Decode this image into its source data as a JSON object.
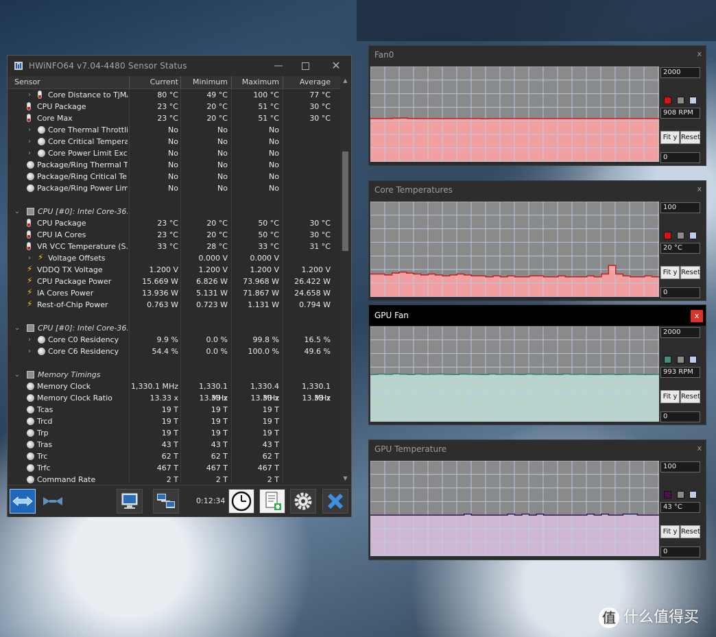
{
  "window": {
    "title": "HWiNFO64 v7.04-4480 Sensor Status",
    "columns": [
      "Sensor",
      "Current",
      "Minimum",
      "Maximum",
      "Average"
    ]
  },
  "rows": [
    {
      "kind": "sensor",
      "indent": 2,
      "icon": "thermometer-icon",
      "name": "Core Distance to TjMAX",
      "cur": "80 °C",
      "min": "49 °C",
      "max": "100 °C",
      "avg": "77 °C",
      "expand": true
    },
    {
      "kind": "sensor",
      "indent": 1,
      "icon": "thermometer-icon",
      "name": "CPU Package",
      "cur": "23 °C",
      "min": "20 °C",
      "max": "51 °C",
      "avg": "30 °C"
    },
    {
      "kind": "sensor",
      "indent": 1,
      "icon": "thermometer-icon",
      "name": "Core Max",
      "cur": "23 °C",
      "min": "20 °C",
      "max": "51 °C",
      "avg": "30 °C"
    },
    {
      "kind": "sensor",
      "indent": 2,
      "icon": "status-circle-icon",
      "name": "Core Thermal Throttling",
      "cur": "No",
      "min": "No",
      "max": "No",
      "avg": "",
      "expand": true
    },
    {
      "kind": "sensor",
      "indent": 2,
      "icon": "status-circle-icon",
      "name": "Core Critical Tempera...",
      "cur": "No",
      "min": "No",
      "max": "No",
      "avg": "",
      "expand": true
    },
    {
      "kind": "sensor",
      "indent": 2,
      "icon": "status-circle-icon",
      "name": "Core Power Limit Exc...",
      "cur": "No",
      "min": "No",
      "max": "No",
      "avg": "",
      "expand": true
    },
    {
      "kind": "sensor",
      "indent": 1,
      "icon": "status-circle-icon",
      "name": "Package/Ring Thermal T...",
      "cur": "No",
      "min": "No",
      "max": "No",
      "avg": ""
    },
    {
      "kind": "sensor",
      "indent": 1,
      "icon": "status-circle-icon",
      "name": "Package/Ring Critical Te...",
      "cur": "No",
      "min": "No",
      "max": "No",
      "avg": ""
    },
    {
      "kind": "sensor",
      "indent": 1,
      "icon": "status-circle-icon",
      "name": "Package/Ring Power Limi...",
      "cur": "No",
      "min": "No",
      "max": "No",
      "avg": ""
    },
    {
      "kind": "blank"
    },
    {
      "kind": "group",
      "name": "CPU [#0]: Intel Core-36...",
      "icon": "chip-icon"
    },
    {
      "kind": "sensor",
      "indent": 1,
      "icon": "thermometer-icon",
      "name": "CPU Package",
      "cur": "23 °C",
      "min": "20 °C",
      "max": "50 °C",
      "avg": "30 °C"
    },
    {
      "kind": "sensor",
      "indent": 1,
      "icon": "thermometer-icon",
      "name": "CPU IA Cores",
      "cur": "23 °C",
      "min": "20 °C",
      "max": "50 °C",
      "avg": "30 °C"
    },
    {
      "kind": "sensor",
      "indent": 1,
      "icon": "thermometer-icon",
      "name": "VR VCC Temperature (S...",
      "cur": "33 °C",
      "min": "28 °C",
      "max": "33 °C",
      "avg": "31 °C"
    },
    {
      "kind": "sensor",
      "indent": 2,
      "icon": "lightning-icon",
      "name": "Voltage Offsets",
      "cur": "",
      "min": "0.000 V",
      "max": "0.000 V",
      "avg": "",
      "expand": true
    },
    {
      "kind": "sensor",
      "indent": 1,
      "icon": "lightning-icon",
      "name": "VDDQ TX Voltage",
      "cur": "1.200 V",
      "min": "1.200 V",
      "max": "1.200 V",
      "avg": "1.200 V"
    },
    {
      "kind": "sensor",
      "indent": 1,
      "icon": "lightning-icon",
      "name": "CPU Package Power",
      "cur": "15.669 W",
      "min": "6.826 W",
      "max": "73.968 W",
      "avg": "26.422 W"
    },
    {
      "kind": "sensor",
      "indent": 1,
      "icon": "lightning-icon",
      "name": "IA Cores Power",
      "cur": "13.936 W",
      "min": "5.131 W",
      "max": "71.867 W",
      "avg": "24.658 W"
    },
    {
      "kind": "sensor",
      "indent": 1,
      "icon": "lightning-icon",
      "name": "Rest-of-Chip Power",
      "cur": "0.763 W",
      "min": "0.723 W",
      "max": "1.131 W",
      "avg": "0.794 W"
    },
    {
      "kind": "blank"
    },
    {
      "kind": "group",
      "name": "CPU [#0]: Intel Core-36...",
      "icon": "chip-icon"
    },
    {
      "kind": "sensor",
      "indent": 2,
      "icon": "status-circle-icon",
      "name": "Core C0 Residency",
      "cur": "9.9 %",
      "min": "0.0 %",
      "max": "99.8 %",
      "avg": "16.5 %",
      "expand": true
    },
    {
      "kind": "sensor",
      "indent": 2,
      "icon": "status-circle-icon",
      "name": "Core C6 Residency",
      "cur": "54.4 %",
      "min": "0.0 %",
      "max": "100.0 %",
      "avg": "49.6 %",
      "expand": true
    },
    {
      "kind": "blank"
    },
    {
      "kind": "group",
      "name": "Memory Timings",
      "icon": "memory-icon"
    },
    {
      "kind": "sensor",
      "indent": 1,
      "icon": "status-circle-icon",
      "name": "Memory Clock",
      "cur": "1,330.1 MHz",
      "min": "1,330.1 MHz",
      "max": "1,330.4 MHz",
      "avg": "1,330.1 MHz"
    },
    {
      "kind": "sensor",
      "indent": 1,
      "icon": "status-circle-icon",
      "name": "Memory Clock Ratio",
      "cur": "13.33 x",
      "min": "13.33 x",
      "max": "13.33 x",
      "avg": "13.33 x"
    },
    {
      "kind": "sensor",
      "indent": 1,
      "icon": "status-circle-icon",
      "name": "Tcas",
      "cur": "19 T",
      "min": "19 T",
      "max": "19 T",
      "avg": ""
    },
    {
      "kind": "sensor",
      "indent": 1,
      "icon": "status-circle-icon",
      "name": "Trcd",
      "cur": "19 T",
      "min": "19 T",
      "max": "19 T",
      "avg": ""
    },
    {
      "kind": "sensor",
      "indent": 1,
      "icon": "status-circle-icon",
      "name": "Trp",
      "cur": "19 T",
      "min": "19 T",
      "max": "19 T",
      "avg": ""
    },
    {
      "kind": "sensor",
      "indent": 1,
      "icon": "status-circle-icon",
      "name": "Tras",
      "cur": "43 T",
      "min": "43 T",
      "max": "43 T",
      "avg": ""
    },
    {
      "kind": "sensor",
      "indent": 1,
      "icon": "status-circle-icon",
      "name": "Trc",
      "cur": "62 T",
      "min": "62 T",
      "max": "62 T",
      "avg": ""
    },
    {
      "kind": "sensor",
      "indent": 1,
      "icon": "status-circle-icon",
      "name": "Trfc",
      "cur": "467 T",
      "min": "467 T",
      "max": "467 T",
      "avg": ""
    },
    {
      "kind": "sensor",
      "indent": 1,
      "icon": "status-circle-icon",
      "name": "Command Rate",
      "cur": "2 T",
      "min": "2 T",
      "max": "2 T",
      "avg": ""
    }
  ],
  "toolbar": {
    "timer": "0:12:34",
    "buttons": [
      "expand-arrows-icon",
      "collapse-arrows-icon",
      "monitor-icon",
      "network-icon",
      "clock-icon",
      "report-icon",
      "settings-gear-icon",
      "close-x-icon"
    ]
  },
  "graphs": [
    {
      "id": "fan0",
      "title": "Fan0",
      "close": "x",
      "max_label": "2000",
      "current_label": "908 RPM",
      "min_label": "0",
      "fit_label": "Fit y",
      "reset_label": "Reset",
      "active": false,
      "line_color": "#c0201c",
      "fill_color": "#f0a0a0",
      "swatch_color": "#e01010",
      "scale_max": 2000,
      "values": [
        908,
        908,
        908,
        915,
        920,
        910,
        908,
        908,
        908,
        906,
        908,
        908,
        908,
        908,
        908,
        905,
        908,
        908,
        908,
        908,
        908,
        908,
        908,
        908,
        908,
        908,
        908,
        908,
        908,
        908,
        908,
        908,
        908,
        908,
        908,
        908,
        908,
        908,
        908,
        908
      ]
    },
    {
      "id": "core-temps",
      "title": "Core Temperatures",
      "close": "x",
      "max_label": "100",
      "current_label": "20 °C",
      "min_label": "0",
      "fit_label": "Fit y",
      "reset_label": "Reset",
      "active": false,
      "line_color": "#c0201c",
      "fill_color": "#f0a0a0",
      "swatch_color": "#e01010",
      "scale_max": 100,
      "values": [
        24,
        24,
        23,
        25,
        26,
        25,
        24,
        23,
        24,
        23,
        22,
        23,
        24,
        23,
        22,
        22,
        21,
        22,
        21,
        22,
        21,
        21,
        22,
        22,
        21,
        21,
        22,
        21,
        21,
        21,
        22,
        21,
        24,
        33,
        24,
        22,
        21,
        21,
        22,
        21,
        21
      ]
    },
    {
      "id": "gpu-fan",
      "title": "GPU Fan",
      "close": "x",
      "max_label": "2000",
      "current_label": "993 RPM",
      "min_label": "0",
      "fit_label": "Fit y",
      "reset_label": "Reset",
      "active": true,
      "line_color": "#2f7f6a",
      "fill_color": "#b8d4cc",
      "swatch_color": "#3f8f80",
      "scale_max": 2000,
      "values": [
        990,
        1000,
        993,
        1005,
        995,
        990,
        1000,
        993,
        995,
        1000,
        993,
        990,
        1000,
        995,
        993,
        990,
        1000,
        993,
        995,
        993,
        990,
        1000,
        993,
        995,
        993,
        990,
        1000,
        993,
        995,
        993,
        990,
        993,
        995,
        990,
        993,
        995,
        993,
        990,
        993,
        993
      ]
    },
    {
      "id": "gpu-temp",
      "title": "GPU Temperature",
      "close": "x",
      "max_label": "100",
      "current_label": "43 °C",
      "min_label": "0",
      "fit_label": "Fit y",
      "reset_label": "Reset",
      "active": false,
      "line_color": "#3a1a50",
      "fill_color": "#cdb7d2",
      "swatch_color": "#4a1050",
      "scale_max": 100,
      "values": [
        43,
        43,
        43,
        43,
        43,
        43,
        43,
        43,
        43,
        43,
        43,
        43,
        43,
        44,
        43,
        43,
        43,
        43,
        43,
        44,
        43,
        44,
        43,
        44,
        43,
        43,
        43,
        43,
        43,
        43,
        44,
        43,
        44,
        43,
        43,
        44,
        44,
        43,
        43,
        43,
        43
      ]
    }
  ],
  "watermark": {
    "logo": "值",
    "text": "什么值得买"
  }
}
